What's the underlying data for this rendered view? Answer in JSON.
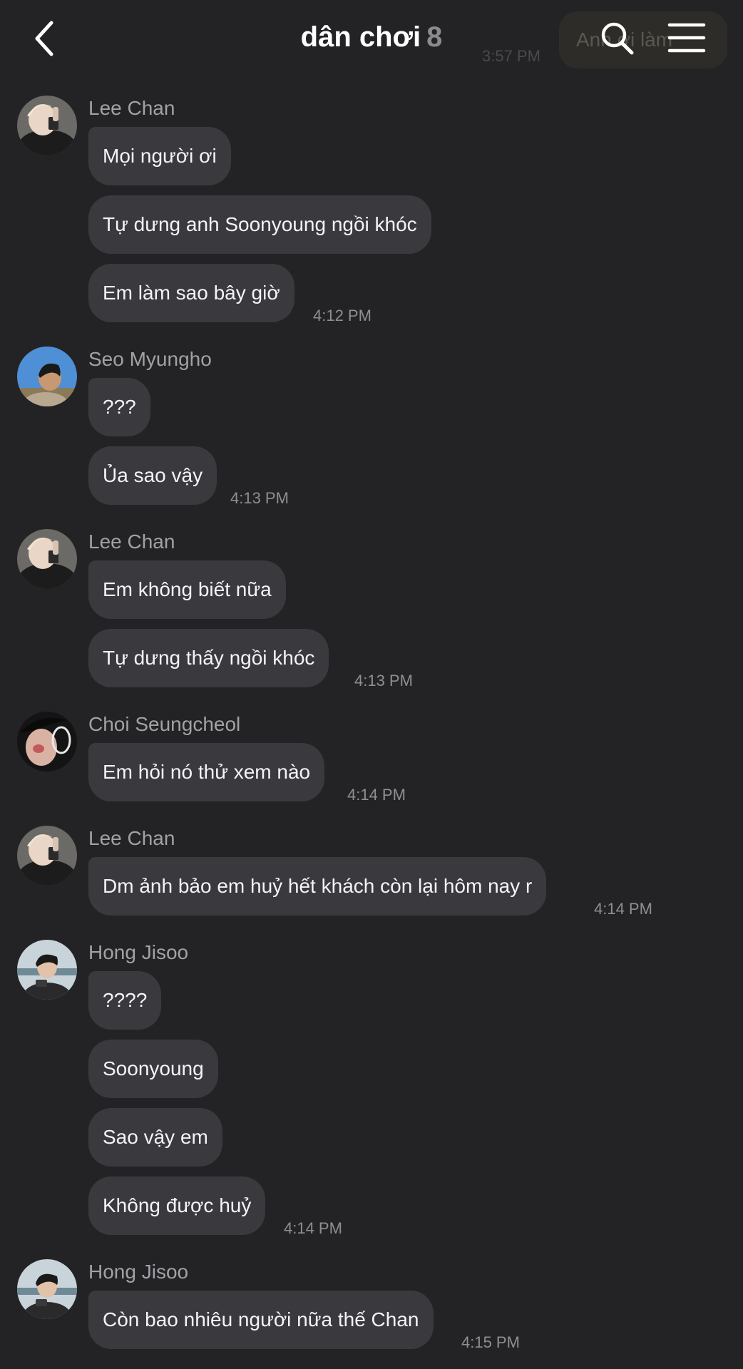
{
  "header": {
    "title": "dân chơi",
    "member_count": "8",
    "ghost_time": "3:57 PM",
    "ghost_text": "Anh ơi làm"
  },
  "messages": [
    {
      "sender": "Lee Chan",
      "avatar": "avatar-lee-chan",
      "bubbles": [
        "Mọi người ơi",
        "Tự dưng anh Soonyoung ngồi khóc",
        "Em làm sao bây giờ"
      ],
      "time": "4:12 PM"
    },
    {
      "sender": "Seo Myungho",
      "avatar": "avatar-seo-myungho",
      "bubbles": [
        "???",
        "Ủa sao vậy"
      ],
      "time": "4:13 PM"
    },
    {
      "sender": "Lee Chan",
      "avatar": "avatar-lee-chan",
      "bubbles": [
        "Em không biết nữa",
        "Tự dưng thấy ngồi khóc"
      ],
      "time": "4:13 PM"
    },
    {
      "sender": "Choi Seungcheol",
      "avatar": "avatar-choi-seungcheol",
      "bubbles": [
        "Em hỏi nó thử xem nào"
      ],
      "time": "4:14 PM"
    },
    {
      "sender": "Lee Chan",
      "avatar": "avatar-lee-chan",
      "bubbles": [
        "Dm ảnh bảo em huỷ hết khách còn lại hôm nay r"
      ],
      "time": "4:14 PM"
    },
    {
      "sender": "Hong Jisoo",
      "avatar": "avatar-hong-jisoo",
      "bubbles": [
        "????",
        "Soonyoung",
        "Sao vậy em",
        "Không được huỷ"
      ],
      "time": "4:14 PM"
    },
    {
      "sender": "Hong Jisoo",
      "avatar": "avatar-hong-jisoo",
      "bubbles": [
        "Còn bao nhiêu người nữa thế Chan"
      ],
      "time": "4:15 PM"
    }
  ]
}
